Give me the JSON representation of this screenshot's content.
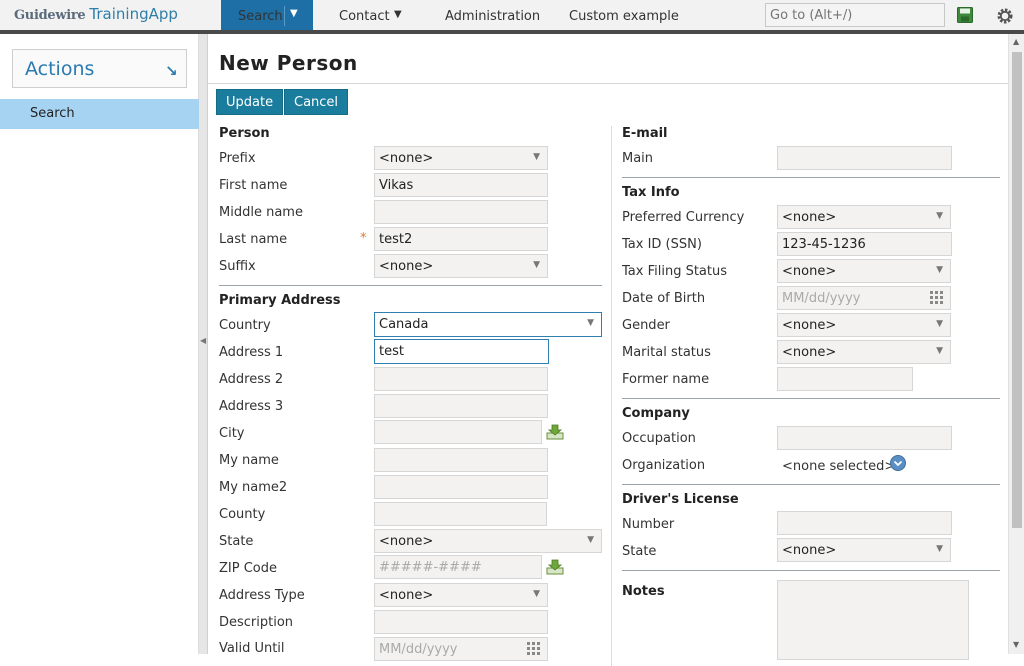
{
  "header": {
    "brand": "Guidewire",
    "app_name": "TrainingApp",
    "tabs": [
      {
        "label": "Search",
        "active": true
      },
      {
        "label": "Contact"
      },
      {
        "label": "Administration"
      },
      {
        "label": "Custom example"
      }
    ],
    "goto_placeholder": "Go to (Alt+/)",
    "icons": [
      "save-icon",
      "gear-icon"
    ]
  },
  "sidebar": {
    "actions_label": "Actions",
    "actions_icon": "arrow-down-right-icon",
    "items": [
      {
        "label": "Search",
        "selected": true
      }
    ]
  },
  "page": {
    "title": "New Person",
    "buttons": {
      "update": "Update",
      "cancel": "Cancel"
    }
  },
  "left": {
    "person": {
      "title": "Person",
      "prefix": {
        "label": "Prefix",
        "value": "<none>"
      },
      "first_name": {
        "label": "First name",
        "value": "Vikas"
      },
      "middle_name": {
        "label": "Middle name",
        "value": ""
      },
      "last_name": {
        "label": "Last name",
        "value": "test2",
        "required_mark": "*"
      },
      "suffix": {
        "label": "Suffix",
        "value": "<none>"
      }
    },
    "address": {
      "title": "Primary Address",
      "country": {
        "label": "Country",
        "value": "Canada"
      },
      "address1": {
        "label": "Address 1",
        "value": "test"
      },
      "address2": {
        "label": "Address 2",
        "value": ""
      },
      "address3": {
        "label": "Address 3",
        "value": ""
      },
      "city": {
        "label": "City",
        "value": ""
      },
      "my_name": {
        "label": "My name",
        "value": ""
      },
      "my_name2": {
        "label": "My name2",
        "value": ""
      },
      "county": {
        "label": "County",
        "value": ""
      },
      "state": {
        "label": "State",
        "value": "<none>"
      },
      "zip": {
        "label": "ZIP Code",
        "placeholder": "#####-####"
      },
      "address_type": {
        "label": "Address Type",
        "value": "<none>"
      },
      "description": {
        "label": "Description",
        "value": ""
      },
      "valid_until": {
        "label": "Valid Until",
        "placeholder": "MM/dd/yyyy"
      }
    }
  },
  "right": {
    "email": {
      "title": "E-mail",
      "main": {
        "label": "Main",
        "value": ""
      }
    },
    "tax": {
      "title": "Tax Info",
      "currency": {
        "label": "Preferred Currency",
        "value": "<none>"
      },
      "tax_id": {
        "label": "Tax ID (SSN)",
        "value": "123-45-1236"
      },
      "filing_status": {
        "label": "Tax Filing Status",
        "value": "<none>"
      },
      "dob": {
        "label": "Date of Birth",
        "placeholder": "MM/dd/yyyy"
      },
      "gender": {
        "label": "Gender",
        "value": "<none>"
      },
      "marital": {
        "label": "Marital status",
        "value": "<none>"
      },
      "former_name": {
        "label": "Former name",
        "value": ""
      }
    },
    "company": {
      "title": "Company",
      "occupation": {
        "label": "Occupation",
        "value": ""
      },
      "organization": {
        "label": "Organization",
        "value": "<none selected>"
      }
    },
    "license": {
      "title": "Driver's License",
      "number": {
        "label": "Number",
        "value": ""
      },
      "state": {
        "label": "State",
        "value": "<none>"
      }
    },
    "notes": {
      "title": "Notes",
      "value": ""
    }
  },
  "colors": {
    "accent_blue": "#1d6fa5",
    "button_teal": "#1a7d9e",
    "selected_item": "#a7d3f2",
    "required": "#e07a2a"
  }
}
